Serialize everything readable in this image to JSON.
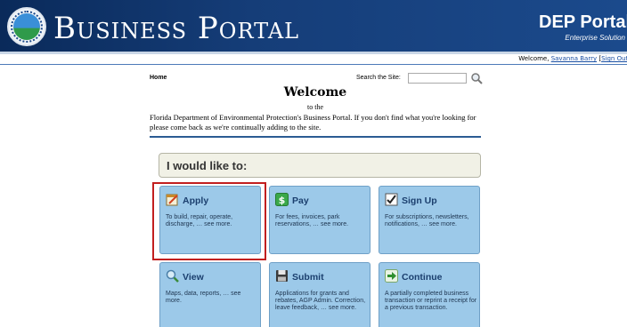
{
  "header": {
    "title": "Business Portal",
    "dep_title": "DEP Portal",
    "dep_subtitle": "Enterprise Solution"
  },
  "user_bar": {
    "welcome": "Welcome,",
    "user_name": "Savanna Barry",
    "sign_out": "Sign Out"
  },
  "breadcrumb": {
    "home": "Home"
  },
  "search": {
    "label": "Search the Site:",
    "value": ""
  },
  "welcome": {
    "heading": "Welcome",
    "to_the": "to the",
    "intro": "Florida Department of Environmental Protection's Business Portal. If you don't find what you're looking for please come back as we're continually adding to the site."
  },
  "like_prompt": "I would like to:",
  "tiles": [
    {
      "title": "Apply",
      "desc": "To build, repair, operate, discharge, … see more."
    },
    {
      "title": "Pay",
      "desc": "For fees, invoices, park reservations, … see more."
    },
    {
      "title": "Sign Up",
      "desc": "For subscriptions, newsletters, notifications, … see more."
    },
    {
      "title": "View",
      "desc": "Maps, data, reports, … see more."
    },
    {
      "title": "Submit",
      "desc": "Applications for grants and rebates, AGP Admin. Correction, leave feedback, … see more."
    },
    {
      "title": "Continue",
      "desc": "A partially completed business transaction or reprint a receipt for a previous transaction."
    }
  ],
  "colors": {
    "header_dark": "#0a2a5a",
    "tile_bg": "#9cc9e9",
    "highlight": "#c21f1f"
  }
}
